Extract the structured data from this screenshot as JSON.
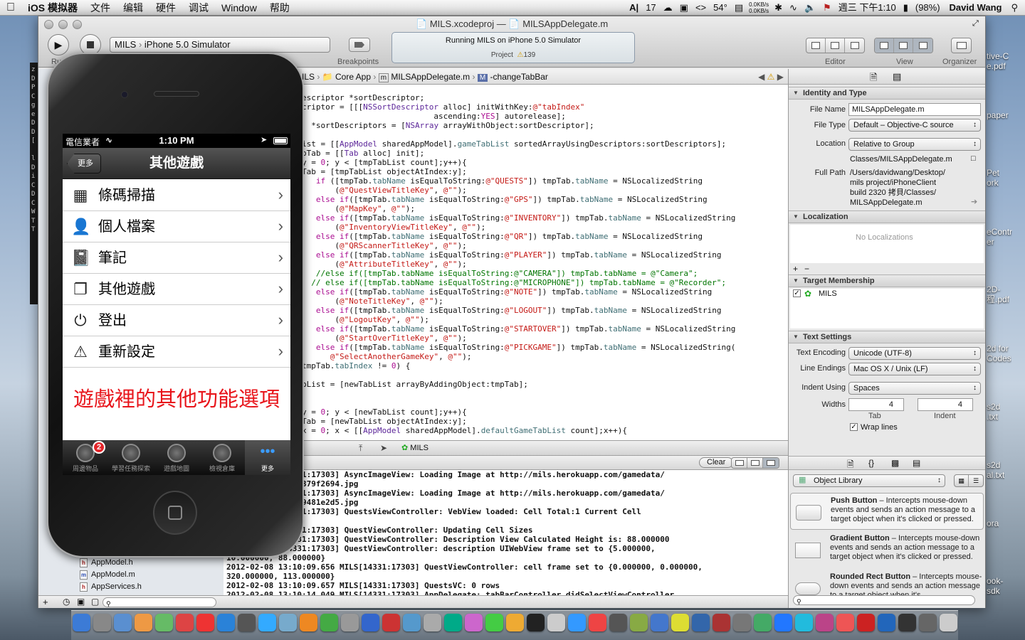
{
  "menubar": {
    "apple": "",
    "app_name": "iOS 模拟器",
    "items": [
      "文件",
      "编辑",
      "硬件",
      "调试",
      "Window",
      "帮助"
    ],
    "status": {
      "input": "17",
      "temp": "54°",
      "net_up": "0.0KB/s",
      "net_down": "0.0KB/s",
      "clock": "週三 下午1:10",
      "battery": "(98%)",
      "user": "David Wang"
    }
  },
  "desktop": {
    "icons": [
      "tive-C\ne.pdf",
      "paper",
      "Pet\nork",
      "eContr\ner",
      "2D-\n程.pdf",
      "2d for\nCodes",
      "s2d\n.txt",
      "s2d\nal.txt",
      "ora",
      "ook-\nsdk"
    ],
    "terminal_chars": "z\nD\nP\nC\ng\ne\nD\nD\n[\n\nl\nD\ni\nC\nD\nC\nW\nT\nT"
  },
  "window": {
    "title_project": "MILS.xcodeproj",
    "title_sep": "—",
    "title_file": "MILSAppDelegate.m",
    "run_label": "Ru",
    "scheme": "MILS",
    "destination": "iPhone 5.0 Simulator",
    "breakpoints_label": "Breakpoints",
    "activity_text": "Running MILS on iPhone 5.0 Simulator",
    "activity_project": "Project",
    "warning_count": "139",
    "editor_label": "Editor",
    "view_label": "View",
    "organizer_label": "Organizer"
  },
  "jumpbar": {
    "crumbs": [
      "ILS",
      "Core App",
      "MILSAppDelegate.m",
      "-changeTabBar"
    ]
  },
  "code_lines": [
    [
      [
        "",
        "escriptor *sortDescriptor;"
      ]
    ],
    [
      [
        "",
        "criptor = [[["
      ],
      [
        "cls",
        "NSSortDescriptor"
      ],
      [
        "",
        " alloc] initWithKey:"
      ],
      [
        "st",
        "@\"tabIndex\""
      ]
    ],
    [
      [
        "",
        "                            ascending:"
      ],
      [
        "kw",
        "YES"
      ],
      [
        "",
        "] autorelease];"
      ]
    ],
    [
      [
        "",
        "  *sortDescriptors = ["
      ],
      [
        "cls",
        "NSArray"
      ],
      [
        "",
        " arrayWithObject:sortDescriptor];"
      ]
    ],
    [
      [
        "",
        ""
      ]
    ],
    [
      [
        "",
        "ist = [["
      ],
      [
        "cls",
        "AppModel"
      ],
      [
        "",
        " sharedAppModel]."
      ],
      [
        "pr",
        "gameTabList"
      ],
      [
        "",
        " sortedArrayUsingDescriptors:sortDescriptors];"
      ]
    ],
    [
      [
        "",
        "pTab = [["
      ],
      [
        "cls",
        "Tab"
      ],
      [
        "",
        " alloc] init];"
      ]
    ],
    [
      [
        "",
        "y = "
      ],
      [
        "kw",
        "0"
      ],
      [
        "",
        "; y < [tmpTabList count];y++){"
      ]
    ],
    [
      [
        "",
        "Tab = [tmpTabList objectAtIndex:y];"
      ]
    ],
    [
      [
        "",
        "   "
      ],
      [
        "kw",
        "if"
      ],
      [
        "",
        " ([tmpTab."
      ],
      [
        "pr",
        "tabName"
      ],
      [
        "",
        " isEqualToString:"
      ],
      [
        "st",
        "@\"QUESTS\""
      ],
      [
        "",
        "]) tmpTab."
      ],
      [
        "pr",
        "tabName"
      ],
      [
        "",
        " = NSLocalizedString"
      ]
    ],
    [
      [
        "",
        "       ("
      ],
      [
        "st",
        "@\"QuestViewTitleKey\""
      ],
      [
        "",
        ", "
      ],
      [
        "st",
        "@\"\""
      ],
      [
        "",
        ");"
      ]
    ],
    [
      [
        "",
        "   "
      ],
      [
        "kw",
        "else if"
      ],
      [
        "",
        "([tmpTab."
      ],
      [
        "pr",
        "tabName"
      ],
      [
        "",
        " isEqualToString:"
      ],
      [
        "st",
        "@\"GPS\""
      ],
      [
        "",
        "]) tmpTab."
      ],
      [
        "pr",
        "tabName"
      ],
      [
        "",
        " = NSLocalizedString"
      ]
    ],
    [
      [
        "",
        "       ("
      ],
      [
        "st",
        "@\"MapKey\""
      ],
      [
        "",
        ", "
      ],
      [
        "st",
        "@\"\""
      ],
      [
        "",
        ");"
      ]
    ],
    [
      [
        "",
        "   "
      ],
      [
        "kw",
        "else if"
      ],
      [
        "",
        "([tmpTab."
      ],
      [
        "pr",
        "tabName"
      ],
      [
        "",
        " isEqualToString:"
      ],
      [
        "st",
        "@\"INVENTORY\""
      ],
      [
        "",
        "]) tmpTab."
      ],
      [
        "pr",
        "tabName"
      ],
      [
        "",
        " = NSLocalizedString"
      ]
    ],
    [
      [
        "",
        "       ("
      ],
      [
        "st",
        "@\"InventoryViewTitleKey\""
      ],
      [
        "",
        ", "
      ],
      [
        "st",
        "@\"\""
      ],
      [
        "",
        ");"
      ]
    ],
    [
      [
        "",
        "   "
      ],
      [
        "kw",
        "else if"
      ],
      [
        "",
        "([tmpTab."
      ],
      [
        "pr",
        "tabName"
      ],
      [
        "",
        " isEqualToString:"
      ],
      [
        "st",
        "@\"QR\""
      ],
      [
        "",
        "]) tmpTab."
      ],
      [
        "pr",
        "tabName"
      ],
      [
        "",
        " = NSLocalizedString"
      ]
    ],
    [
      [
        "",
        "       ("
      ],
      [
        "st",
        "@\"QRScannerTitleKey\""
      ],
      [
        "",
        ", "
      ],
      [
        "st",
        "@\"\""
      ],
      [
        "",
        ");"
      ]
    ],
    [
      [
        "",
        "   "
      ],
      [
        "kw",
        "else if"
      ],
      [
        "",
        "([tmpTab."
      ],
      [
        "pr",
        "tabName"
      ],
      [
        "",
        " isEqualToString:"
      ],
      [
        "st",
        "@\"PLAYER\""
      ],
      [
        "",
        "]) tmpTab."
      ],
      [
        "pr",
        "tabName"
      ],
      [
        "",
        " = NSLocalizedString"
      ]
    ],
    [
      [
        "",
        "       ("
      ],
      [
        "st",
        "@\"AttributeTitleKey\""
      ],
      [
        "",
        ", "
      ],
      [
        "st",
        "@\"\""
      ],
      [
        "",
        ");"
      ]
    ],
    [
      [
        "cm",
        "   //else if([tmpTab.tabName isEqualToString:@\"CAMERA\"]) tmpTab.tabName = @\"Camera\";"
      ]
    ],
    [
      [
        "cm",
        "  // else if([tmpTab.tabName isEqualToString:@\"MICROPHONE\"]) tmpTab.tabName = @\"Recorder\";"
      ]
    ],
    [
      [
        "",
        "   "
      ],
      [
        "kw",
        "else if"
      ],
      [
        "",
        "([tmpTab."
      ],
      [
        "pr",
        "tabName"
      ],
      [
        "",
        " isEqualToString:"
      ],
      [
        "st",
        "@\"NOTE\""
      ],
      [
        "",
        "]) tmpTab."
      ],
      [
        "pr",
        "tabName"
      ],
      [
        "",
        " = NSLocalizedString"
      ]
    ],
    [
      [
        "",
        "       ("
      ],
      [
        "st",
        "@\"NoteTitleKey\""
      ],
      [
        "",
        ", "
      ],
      [
        "st",
        "@\"\""
      ],
      [
        "",
        ");"
      ]
    ],
    [
      [
        "",
        "   "
      ],
      [
        "kw",
        "else if"
      ],
      [
        "",
        "([tmpTab."
      ],
      [
        "pr",
        "tabName"
      ],
      [
        "",
        " isEqualToString:"
      ],
      [
        "st",
        "@\"LOGOUT\""
      ],
      [
        "",
        "]) tmpTab."
      ],
      [
        "pr",
        "tabName"
      ],
      [
        "",
        " = NSLocalizedString"
      ]
    ],
    [
      [
        "",
        "       ("
      ],
      [
        "st",
        "@\"LogoutKey\""
      ],
      [
        "",
        ", "
      ],
      [
        "st",
        "@\"\""
      ],
      [
        "",
        ");"
      ]
    ],
    [
      [
        "",
        "   "
      ],
      [
        "kw",
        "else if"
      ],
      [
        "",
        "([tmpTab."
      ],
      [
        "pr",
        "tabName"
      ],
      [
        "",
        " isEqualToString:"
      ],
      [
        "st",
        "@\"STARTOVER\""
      ],
      [
        "",
        "]) tmpTab."
      ],
      [
        "pr",
        "tabName"
      ],
      [
        "",
        " = NSLocalizedString"
      ]
    ],
    [
      [
        "",
        "       ("
      ],
      [
        "st",
        "@\"StartOverTitleKey\""
      ],
      [
        "",
        ", "
      ],
      [
        "st",
        "@\"\""
      ],
      [
        "",
        ");"
      ]
    ],
    [
      [
        "",
        "   "
      ],
      [
        "kw",
        "else if"
      ],
      [
        "",
        "([tmpTab."
      ],
      [
        "pr",
        "tabName"
      ],
      [
        "",
        " isEqualToString:"
      ],
      [
        "st",
        "@\"PICKGAME\""
      ],
      [
        "",
        "]) tmpTab."
      ],
      [
        "pr",
        "tabName"
      ],
      [
        "",
        " = NSLocalizedString("
      ]
    ],
    [
      [
        "",
        "      "
      ],
      [
        "st",
        "@\"SelectAnotherGameKey\""
      ],
      [
        "",
        ", "
      ],
      [
        "st",
        "@\"\""
      ],
      [
        "",
        ");"
      ]
    ],
    [
      [
        "",
        "tmpTab."
      ],
      [
        "pr",
        "tabIndex"
      ],
      [
        "",
        " != "
      ],
      [
        "kw",
        "0"
      ],
      [
        "",
        ") {"
      ]
    ],
    [
      [
        "",
        ""
      ]
    ],
    [
      [
        "",
        "bList = [newTabList arrayByAddingObject:tmpTab];"
      ]
    ],
    [
      [
        "",
        ""
      ]
    ],
    [
      [
        "",
        ""
      ]
    ],
    [
      [
        "",
        "y = "
      ],
      [
        "kw",
        "0"
      ],
      [
        "",
        "; y < [newTabList count];y++){"
      ]
    ],
    [
      [
        "",
        "Tab = [newTabList objectAtIndex:y];"
      ]
    ],
    [
      [
        "",
        "x = "
      ],
      [
        "kw",
        "0"
      ],
      [
        "",
        "; x < [["
      ],
      [
        "cls",
        "AppModel"
      ],
      [
        "",
        " sharedAppModel]."
      ],
      [
        "pr",
        "defaultGameTabList"
      ],
      [
        "",
        " count];x++){"
      ]
    ]
  ],
  "debug": {
    "target": "MILS",
    "clear_label": "Clear"
  },
  "console_lines": [
    "09.497 MILS[14331:17303] AsyncImageView: Loading Image at http://mils.herokuapp.com/gamedata/",
    "53fa4fbf3244106a379f2694.jpg",
    "09.503 MILS[14331:17303] AsyncImageView: Loading Image at http://mils.herokuapp.com/gamedata/",
    "a36232249e27522a9481e2d5.jpg",
    "09.554 MILS[14331:17303] QuestsViewController: VebView loaded: Cell Total:1 Current Cell",
    "",
    "09.655 MILS[14331:17303] QuestViewController: Updating Cell Sizes",
    "09.655 MILS[14331:17303] QuestViewController: Description View Calculated Height is: 88.000000",
    "09.656 MILS[14331:17303] QuestViewController: description UIWebView frame set to {5.000000,",
    "10.000000, 88.000000}",
    "2012-02-08 13:10:09.656 MILS[14331:17303] QuestViewController: cell frame set to {0.000000, 0.000000,",
    "320.000000, 113.000000}",
    "2012-02-08 13:10:09.657 MILS[14331:17303] QuestsVC: 0 rows",
    "2012-02-08 13:10:14.049 MILS[14331:17303] AppDelegate: tabBarController didSelectViewController"
  ],
  "navigator": {
    "files": [
      {
        "ext": "h",
        "name": "AppModel.h"
      },
      {
        "ext": "m",
        "name": "AppModel.m"
      },
      {
        "ext": "h",
        "name": "AppServices.h"
      }
    ]
  },
  "inspector": {
    "identity": {
      "header": "Identity and Type",
      "file_name_label": "File Name",
      "file_name": "MILSAppDelegate.m",
      "file_type_label": "File Type",
      "file_type": "Default – Objective-C source",
      "location_label": "Location",
      "location": "Relative to Group",
      "location_path": "Classes/MILSAppDelegate.m",
      "full_path_label": "Full Path",
      "full_path": [
        "/Users/davidwang/Desktop/",
        "mils project/iPhoneClient",
        "build 2320 拷貝/Classes/",
        "MILSAppDelegate.m"
      ]
    },
    "localization": {
      "header": "Localization",
      "empty": "No Localizations"
    },
    "target": {
      "header": "Target Membership",
      "item": "MILS"
    },
    "text_settings": {
      "header": "Text Settings",
      "encoding_label": "Text Encoding",
      "encoding": "Unicode (UTF-8)",
      "endings_label": "Line Endings",
      "endings": "Mac OS X / Unix (LF)",
      "indent_using_label": "Indent Using",
      "indent_using": "Spaces",
      "widths_label": "Widths",
      "tab_width": "4",
      "indent_width": "4",
      "tab_label": "Tab",
      "indent_label": "Indent",
      "wrap_label": "Wrap lines"
    },
    "library": {
      "selector": "Object Library",
      "items": [
        {
          "title": "Push Button",
          "desc": " – Intercepts mouse-down events and sends an action message to a target object when it's clicked or pressed."
        },
        {
          "title": "Gradient Button",
          "desc": " – Intercepts mouse-down events and sends an action message to a target object when it's clicked or pressed."
        },
        {
          "title": "Rounded Rect Button",
          "desc": " – Intercepts mouse-down events and sends an action message to a target object when it's..."
        }
      ]
    }
  },
  "simulator": {
    "carrier": "電信業者",
    "time": "1:10 PM",
    "back_label": "更多",
    "nav_title": "其他遊戲",
    "rows": [
      {
        "icon": "qr-code-icon",
        "glyph": "▦",
        "label": "條碼掃描"
      },
      {
        "icon": "person-icon",
        "glyph": "👤",
        "label": "個人檔案"
      },
      {
        "icon": "notebook-icon",
        "glyph": "📓",
        "label": "筆記"
      },
      {
        "icon": "pages-icon",
        "glyph": "❐",
        "label": "其他遊戲"
      },
      {
        "icon": "power-icon",
        "glyph": "⏻",
        "label": "登出"
      },
      {
        "icon": "warning-icon",
        "glyph": "⚠",
        "label": "重新設定"
      }
    ],
    "caption": "遊戲裡的其他功能選項",
    "caption_color": "#e8151b",
    "tabs": [
      {
        "label": "周邊物品",
        "badge": "2"
      },
      {
        "label": "學習任務探索",
        "badge": ""
      },
      {
        "label": "遊戲地圖",
        "badge": ""
      },
      {
        "label": "檢視倉庫",
        "badge": ""
      },
      {
        "label": "更多",
        "badge": ""
      }
    ]
  }
}
